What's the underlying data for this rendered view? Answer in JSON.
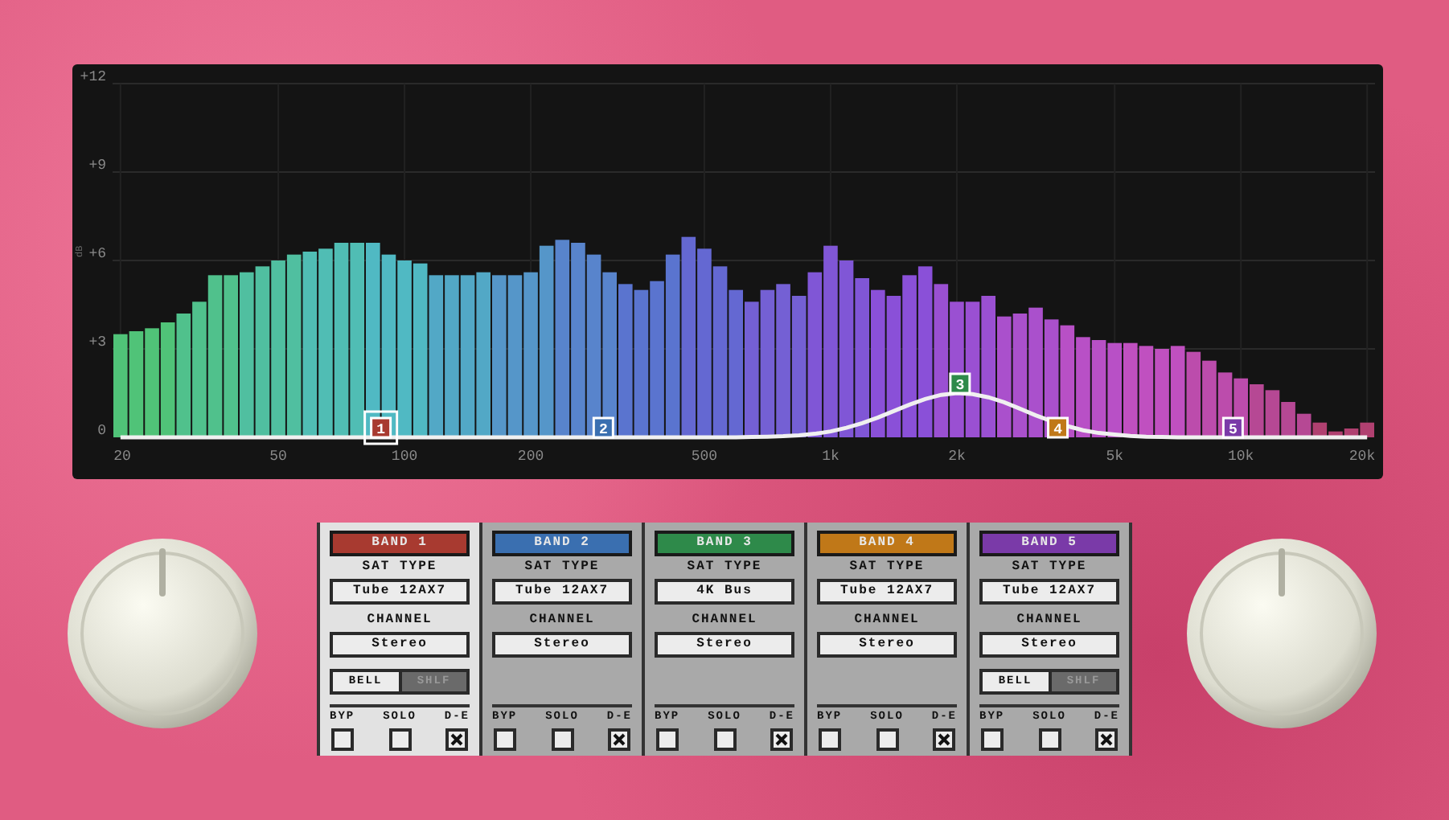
{
  "analyzer": {
    "chart_data": {
      "type": "bar",
      "ylabel": "dB",
      "grid": true,
      "ylim": [
        0,
        12
      ],
      "categories": [
        "20",
        null,
        null,
        null,
        null,
        null,
        null,
        null,
        null,
        null,
        "50",
        null,
        null,
        null,
        null,
        null,
        null,
        null,
        "100",
        null,
        null,
        null,
        null,
        null,
        null,
        null,
        "200",
        null,
        null,
        null,
        null,
        null,
        null,
        null,
        null,
        null,
        null,
        "500",
        null,
        null,
        null,
        null,
        null,
        null,
        null,
        "1k",
        null,
        null,
        null,
        null,
        null,
        null,
        null,
        "2k",
        null,
        null,
        null,
        null,
        null,
        null,
        null,
        null,
        null,
        "5k",
        null,
        null,
        null,
        null,
        null,
        null,
        null,
        "10k",
        null,
        null,
        null,
        null,
        null,
        null,
        null,
        "20k"
      ],
      "yticks": [
        {
          "value": 0,
          "label": "0"
        },
        {
          "value": 3,
          "label": "+3"
        },
        {
          "value": 6,
          "label": "+6"
        },
        {
          "value": 9,
          "label": "+9"
        },
        {
          "value": 12,
          "label": "+12"
        }
      ],
      "series": [
        {
          "colors": [
            "#50c378",
            "#50c378",
            "#50c378",
            "#50c378",
            "#50c18c",
            "#50c18c",
            "#50c18c",
            "#50c18c",
            "#50bfa0",
            "#50bfa0",
            "#50bfa0",
            "#50bfa0",
            "#50bdb4",
            "#50bdb4",
            "#50bdb4",
            "#50bdb4",
            "#50b9c3",
            "#50b9c3",
            "#50b9c3",
            "#50b9c3",
            "#52a8c6",
            "#52a8c6",
            "#52a8c6",
            "#52a8c6",
            "#5596c9",
            "#5596c9",
            "#5596c9",
            "#5596c9",
            "#5884cc",
            "#5884cc",
            "#5884cc",
            "#5884cc",
            "#5a74cf",
            "#5a74cf",
            "#5a74cf",
            "#5a74cf",
            "#6468d2",
            "#6468d2",
            "#6468d2",
            "#6468d2",
            "#7460d4",
            "#7460d4",
            "#7460d4",
            "#7460d4",
            "#8056d6",
            "#8056d6",
            "#8056d6",
            "#8056d6",
            "#8a50d8",
            "#8a50d8",
            "#8a50d8",
            "#8a50d8",
            "#9a50d2",
            "#9a50d2",
            "#9a50d2",
            "#9a50d2",
            "#aa50cc",
            "#aa50cc",
            "#aa50cc",
            "#aa50cc",
            "#b850c6",
            "#b850c6",
            "#b850c6",
            "#b850c6",
            "#c050c0",
            "#c050c0",
            "#c050c0",
            "#c050c0",
            "#bc4cac",
            "#bc4cac",
            "#bc4cac",
            "#bc4cac",
            "#b64894",
            "#b64894",
            "#b64894",
            "#b64894",
            "#b04070",
            "#b04070",
            "#b04070",
            "#b04070"
          ],
          "values": [
            3.5,
            3.6,
            3.7,
            3.9,
            4.2,
            4.6,
            5.5,
            5.5,
            5.6,
            5.8,
            6.0,
            6.2,
            6.3,
            6.4,
            6.6,
            6.6,
            6.6,
            6.2,
            6.0,
            5.9,
            5.5,
            5.5,
            5.5,
            5.6,
            5.5,
            5.5,
            5.6,
            6.5,
            6.7,
            6.6,
            6.2,
            5.6,
            5.2,
            5.0,
            5.3,
            6.2,
            6.8,
            6.4,
            5.8,
            5.0,
            4.6,
            5.0,
            5.2,
            4.8,
            5.6,
            6.5,
            6.0,
            5.4,
            5.0,
            4.8,
            5.5,
            5.8,
            5.2,
            4.6,
            4.6,
            4.8,
            4.1,
            4.2,
            4.4,
            4.0,
            3.8,
            3.4,
            3.3,
            3.2,
            3.2,
            3.1,
            3.0,
            3.1,
            2.9,
            2.6,
            2.2,
            2.0,
            1.8,
            1.6,
            1.2,
            0.8,
            0.5,
            0.2,
            0.3,
            0.5
          ]
        },
        {
          "type": "line",
          "color": "#f0f0f0",
          "values": [
            0,
            0,
            0,
            0,
            0,
            0,
            0,
            0,
            0,
            0,
            0,
            0,
            0,
            0,
            0,
            0,
            0,
            0,
            0,
            0,
            0,
            0,
            0,
            0,
            0,
            0,
            0,
            0,
            0,
            0,
            0,
            0,
            0,
            0,
            0,
            0,
            0,
            0,
            0,
            0,
            0.01,
            0.02,
            0.04,
            0.07,
            0.12,
            0.2,
            0.32,
            0.48,
            0.67,
            0.89,
            1.11,
            1.3,
            1.44,
            1.5,
            1.47,
            1.36,
            1.19,
            0.97,
            0.75,
            0.55,
            0.38,
            0.24,
            0.15,
            0.09,
            0.05,
            0.02,
            0.01,
            0,
            0,
            0,
            0,
            0,
            0,
            0,
            0,
            0,
            0,
            0,
            0,
            0
          ]
        }
      ]
    },
    "eq_nodes": [
      {
        "label": "1",
        "color": "#a83a30",
        "selected": true
      },
      {
        "label": "2",
        "color": "#3a6fb0",
        "selected": false
      },
      {
        "label": "3",
        "color": "#2e8a4a",
        "selected": false
      },
      {
        "label": "4",
        "color": "#c07818",
        "selected": false
      },
      {
        "label": "5",
        "color": "#7a3aa8",
        "selected": false
      }
    ]
  },
  "bands": [
    {
      "title": "BAND 1",
      "color": "#a83a30",
      "selected": true,
      "sat_type_label": "SAT TYPE",
      "sat_type": "Tube 12AX7",
      "channel_label": "CHANNEL",
      "channel": "Stereo",
      "shape": [
        {
          "label": "BELL",
          "selected": true
        },
        {
          "label": "SHLF",
          "selected": false
        }
      ],
      "toggles": [
        {
          "label": "BYP",
          "checked": false
        },
        {
          "label": "SOLO",
          "checked": false
        },
        {
          "label": "D-E",
          "checked": true
        }
      ]
    },
    {
      "title": "BAND 2",
      "color": "#3a6fb0",
      "selected": false,
      "sat_type_label": "SAT TYPE",
      "sat_type": "Tube 12AX7",
      "channel_label": "CHANNEL",
      "channel": "Stereo",
      "toggles": [
        {
          "label": "BYP",
          "checked": false
        },
        {
          "label": "SOLO",
          "checked": false
        },
        {
          "label": "D-E",
          "checked": true
        }
      ]
    },
    {
      "title": "BAND 3",
      "color": "#2e8a4a",
      "selected": false,
      "sat_type_label": "SAT TYPE",
      "sat_type": "4K Bus",
      "channel_label": "CHANNEL",
      "channel": "Stereo",
      "toggles": [
        {
          "label": "BYP",
          "checked": false
        },
        {
          "label": "SOLO",
          "checked": false
        },
        {
          "label": "D-E",
          "checked": true
        }
      ]
    },
    {
      "title": "BAND 4",
      "color": "#c07818",
      "selected": false,
      "sat_type_label": "SAT TYPE",
      "sat_type": "Tube 12AX7",
      "channel_label": "CHANNEL",
      "channel": "Stereo",
      "toggles": [
        {
          "label": "BYP",
          "checked": false
        },
        {
          "label": "SOLO",
          "checked": false
        },
        {
          "label": "D-E",
          "checked": true
        }
      ]
    },
    {
      "title": "BAND 5",
      "color": "#7a3aa8",
      "selected": false,
      "sat_type_label": "SAT TYPE",
      "sat_type": "Tube 12AX7",
      "channel_label": "CHANNEL",
      "channel": "Stereo",
      "shape": [
        {
          "label": "BELL",
          "selected": true
        },
        {
          "label": "SHLF",
          "selected": false
        }
      ],
      "toggles": [
        {
          "label": "BYP",
          "checked": false
        },
        {
          "label": "SOLO",
          "checked": false
        },
        {
          "label": "D-E",
          "checked": true
        }
      ]
    }
  ]
}
